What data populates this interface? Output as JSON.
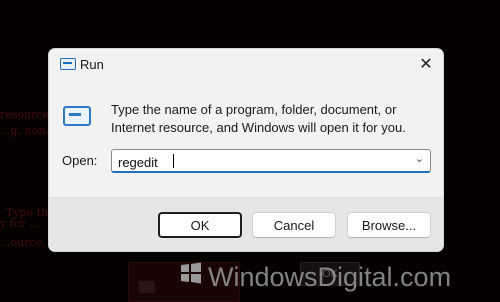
{
  "dialog": {
    "title": "Run",
    "description": "Type the name of a program, folder, document, or Internet resource, and Windows will open it for you.",
    "open_label": "Open:",
    "open_value": "regedit",
    "buttons": {
      "ok": "OK",
      "cancel": "Cancel",
      "browse": "Browse..."
    },
    "icons": {
      "title": "run-app-icon",
      "close": "close-icon",
      "run": "run-app-icon",
      "dropdown": "chevron-down-icon"
    },
    "accent": "#1f6fc0"
  },
  "watermark": {
    "text": "WindowsDigital.com"
  },
  "background_text": {
    "line1": "resource, and Windows will o...",
    "line2": "...g, non...",
    "line3": "Type the name of a program, folder, d",
    "line4": "y for ... ",
    "line5": "...ource, and Windows will open it for you.",
    "ghost_button": "OK"
  }
}
